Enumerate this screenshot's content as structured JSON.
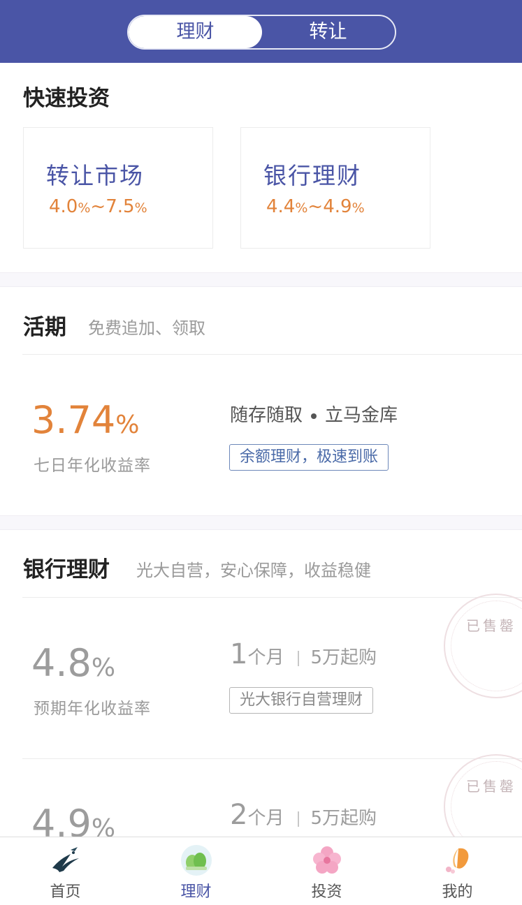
{
  "header": {
    "tabs": [
      {
        "label": "理财",
        "active": true
      },
      {
        "label": "转让",
        "active": false
      }
    ]
  },
  "quick_invest": {
    "title": "快速投资",
    "cards": [
      {
        "title": "转让市场",
        "rate_low": "4.0",
        "rate_high": "7.5"
      },
      {
        "title": "银行理财",
        "rate_low": "4.4",
        "rate_high": "4.9"
      }
    ]
  },
  "demand": {
    "title": "活期",
    "subtitle": "免费追加、领取",
    "rate": "3.74",
    "rate_label": "七日年化收益率",
    "desc_left": "随存随取",
    "desc_right": "立马金库",
    "tag": "余额理财，极速到账"
  },
  "bank": {
    "title": "银行理财",
    "subtitle": "光大自营，安心保障，收益稳健",
    "products": [
      {
        "rate": "4.8",
        "rate_label": "预期年化收益率",
        "term_num": "1",
        "term_unit": "个月",
        "min": "5万起购",
        "tag": "光大银行自营理财",
        "stamp": "已售罄"
      },
      {
        "rate": "4.9",
        "term_num": "2",
        "term_unit": "个月",
        "min": "5万起购",
        "stamp": "已售罄"
      }
    ]
  },
  "percent_sign": "%",
  "tilde": "~",
  "bottom_nav": [
    {
      "label": "首页",
      "icon": "swallow-icon",
      "active": false
    },
    {
      "label": "理财",
      "icon": "plant-icon",
      "active": true
    },
    {
      "label": "投资",
      "icon": "flower-icon",
      "active": false
    },
    {
      "label": "我的",
      "icon": "butterfly-icon",
      "active": false
    }
  ],
  "colors": {
    "brand": "#4a55a6",
    "accent": "#e2833a"
  }
}
